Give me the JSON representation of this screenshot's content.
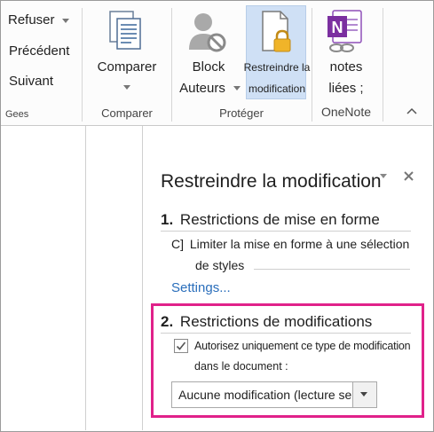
{
  "ribbon": {
    "review_group": {
      "refuser": "Refuser",
      "precedent": "Précédent",
      "suivant": "Suivant",
      "label": "Gees"
    },
    "compare_group": {
      "button": "Comparer",
      "label": "Comparer"
    },
    "protect_group": {
      "block_line1": "Block",
      "block_line2": "Auteurs",
      "restrict_line1": "Restreindre la",
      "restrict_line2": "modification",
      "label": "Protéger"
    },
    "onenote_group": {
      "notes_line1": "notes",
      "notes_line2": "liées ;",
      "label": "OneNote"
    }
  },
  "pane": {
    "title": "Restreindre la modification",
    "section1": {
      "number": "1.",
      "title": "Restrictions de mise en forme",
      "checkbox_marker": "C]",
      "text_line1": "Limiter la mise en forme à une sélection",
      "text_line2": "de styles",
      "settings_link": "Settings..."
    },
    "section2": {
      "number": "2.",
      "title": "Restrictions de modifications",
      "checkbox_line1": "Autorisez uniquement ce type de modification",
      "checkbox_line2": "dans le document :",
      "dropdown_value": "Aucune modification (lecture seule)"
    }
  },
  "colors": {
    "highlight_border": "#e0218a",
    "link": "#2a6ebb",
    "selected_button_bg": "#cfe0f5"
  }
}
